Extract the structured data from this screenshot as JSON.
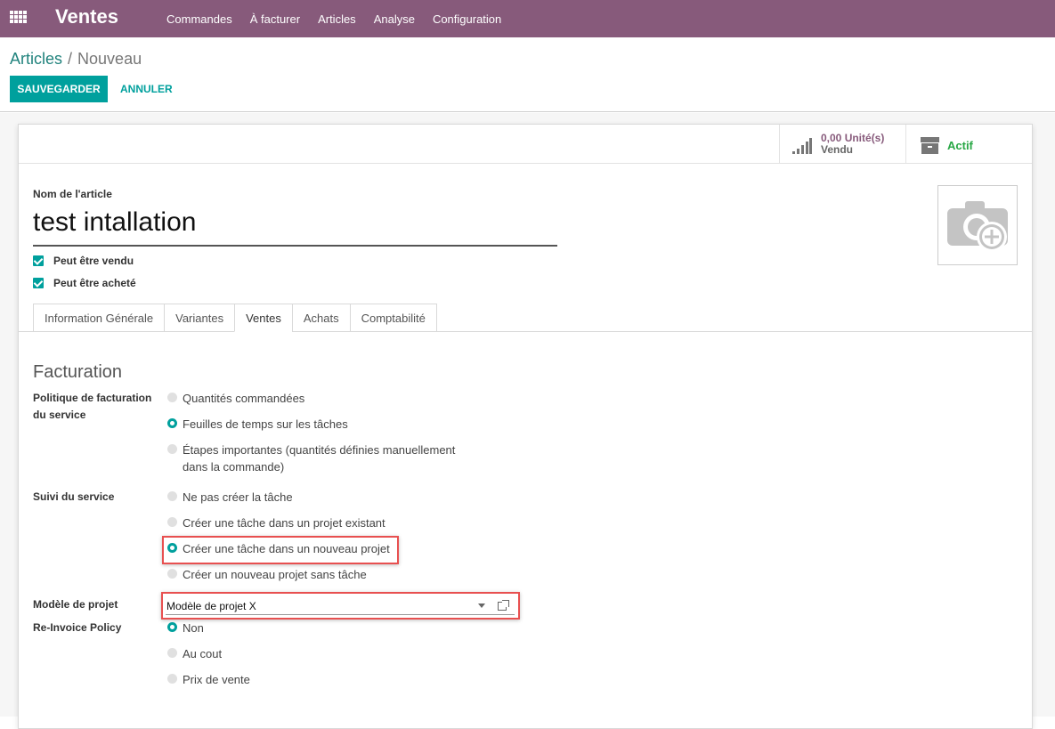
{
  "navbar": {
    "app_title": "Ventes",
    "menu": [
      "Commandes",
      "À facturer",
      "Articles",
      "Analyse",
      "Configuration"
    ]
  },
  "breadcrumb": {
    "parent": "Articles",
    "separator": "/",
    "current": "Nouveau"
  },
  "actions": {
    "save": "SAUVEGARDER",
    "cancel": "ANNULER"
  },
  "stats": {
    "sold_value": "0,00 Unité(s)",
    "sold_label": "Vendu",
    "active_label": "Actif"
  },
  "product": {
    "name_label": "Nom de l'article",
    "name_value": "test intallation",
    "can_be_sold": "Peut être vendu",
    "can_be_purchased": "Peut être acheté"
  },
  "tabs": [
    "Information Générale",
    "Variantes",
    "Ventes",
    "Achats",
    "Comptabilité"
  ],
  "active_tab": "Ventes",
  "invoicing": {
    "title": "Facturation",
    "policy_label": "Politique de facturation du service",
    "policy_options": [
      "Quantités commandées",
      "Feuilles de temps sur les tâches",
      "Étapes importantes (quantités définies manuellement dans la commande)"
    ],
    "tracking_label": "Suivi du service",
    "tracking_options": [
      "Ne pas créer la tâche",
      "Créer une tâche dans un projet existant",
      "Créer une tâche dans un nouveau projet",
      "Créer un nouveau projet sans tâche"
    ],
    "project_template_label": "Modèle de projet",
    "project_template_value": "Modèle de projet X",
    "reinvoice_label": "Re-Invoice Policy",
    "reinvoice_options": [
      "Non",
      "Au cout",
      "Prix de vente"
    ]
  },
  "colors": {
    "navbar": "#875a7b",
    "primary": "#00a09d",
    "highlight": "#e85050",
    "active": "#28a745"
  }
}
